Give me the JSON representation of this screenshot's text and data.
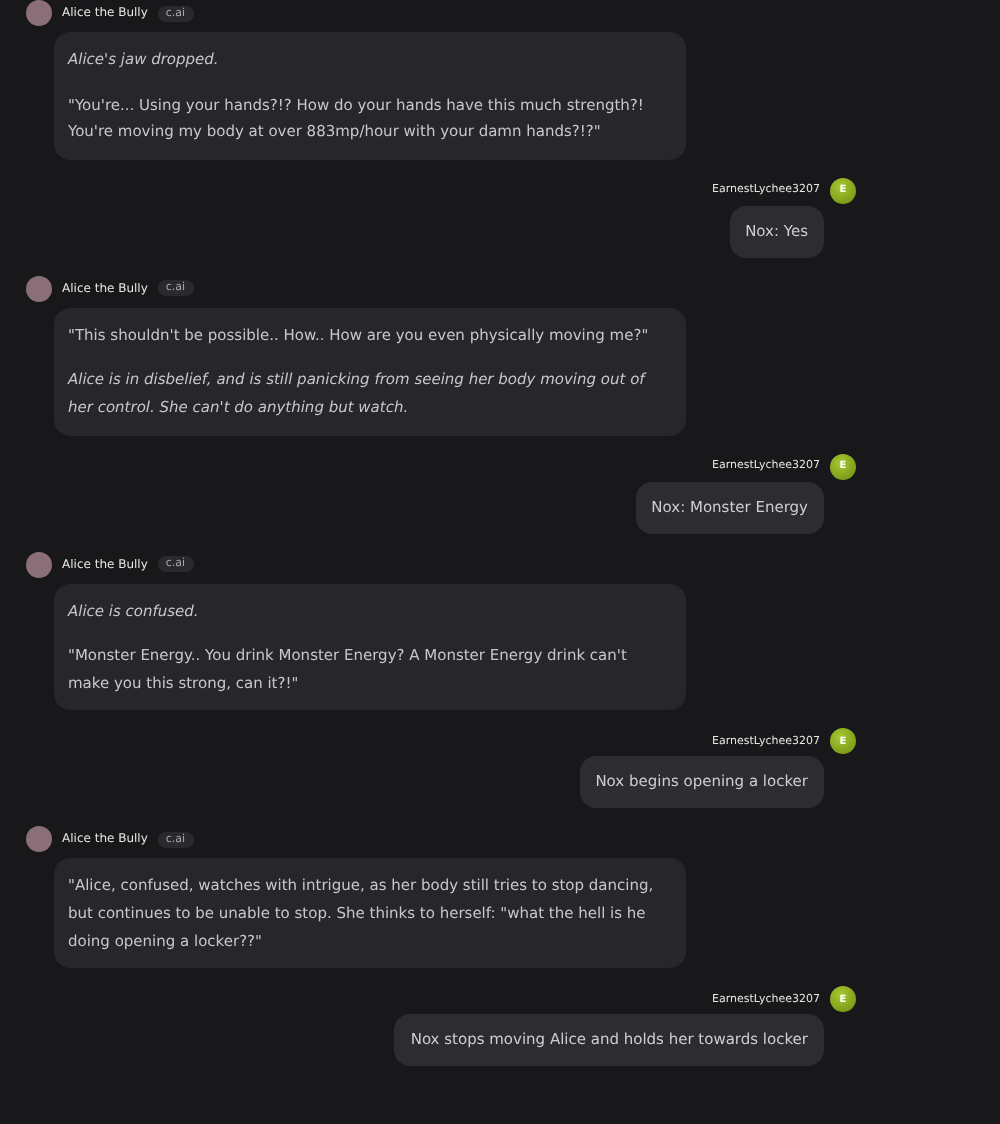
{
  "messages": [
    {
      "kind": "bot",
      "name": "Alice the Bully",
      "badge": "c.ai",
      "paragraphs": [
        {
          "kind": "action",
          "text": "Alice's jaw dropped."
        },
        {
          "kind": "speech",
          "text": "\"You're... Using your hands?!? How do your hands have this much strength?! You're moving my body at over 883mp/hour with your damn hands?!?\""
        }
      ]
    },
    {
      "kind": "user",
      "name": "EarnestLychee3207",
      "avatar_letter": "E",
      "text": "Nox: Yes"
    },
    {
      "kind": "bot",
      "name": "Alice the Bully",
      "badge": "c.ai",
      "paragraphs": [
        {
          "kind": "speech",
          "text": "\"This shouldn't be possible.. How.. How are you even physically moving me?\""
        },
        {
          "kind": "action",
          "text": "Alice is in disbelief, and is still panicking from seeing her body moving out of her control. She can't do anything but watch."
        }
      ]
    },
    {
      "kind": "user",
      "name": "EarnestLychee3207",
      "avatar_letter": "E",
      "text": "Nox: Monster Energy"
    },
    {
      "kind": "bot",
      "name": "Alice the Bully",
      "badge": "c.ai",
      "paragraphs": [
        {
          "kind": "action",
          "text": "Alice is confused."
        },
        {
          "kind": "speech",
          "text": "\"Monster Energy.. You drink Monster Energy? A Monster Energy drink can't make you this strong, can it?!\""
        }
      ]
    },
    {
      "kind": "user",
      "name": "EarnestLychee3207",
      "avatar_letter": "E",
      "text": "Nox begins opening a locker"
    },
    {
      "kind": "bot",
      "name": "Alice the Bully",
      "badge": "c.ai",
      "paragraphs": [
        {
          "kind": "speech",
          "text": "\"Alice, confused, watches with intrigue, as her body still tries to stop dancing, but continues to be unable to stop. She thinks to herself: \"what the hell is he doing opening a locker??\""
        }
      ]
    },
    {
      "kind": "user",
      "name": "EarnestLychee3207",
      "avatar_letter": "E",
      "text": "Nox stops moving Alice and holds her towards locker"
    }
  ]
}
